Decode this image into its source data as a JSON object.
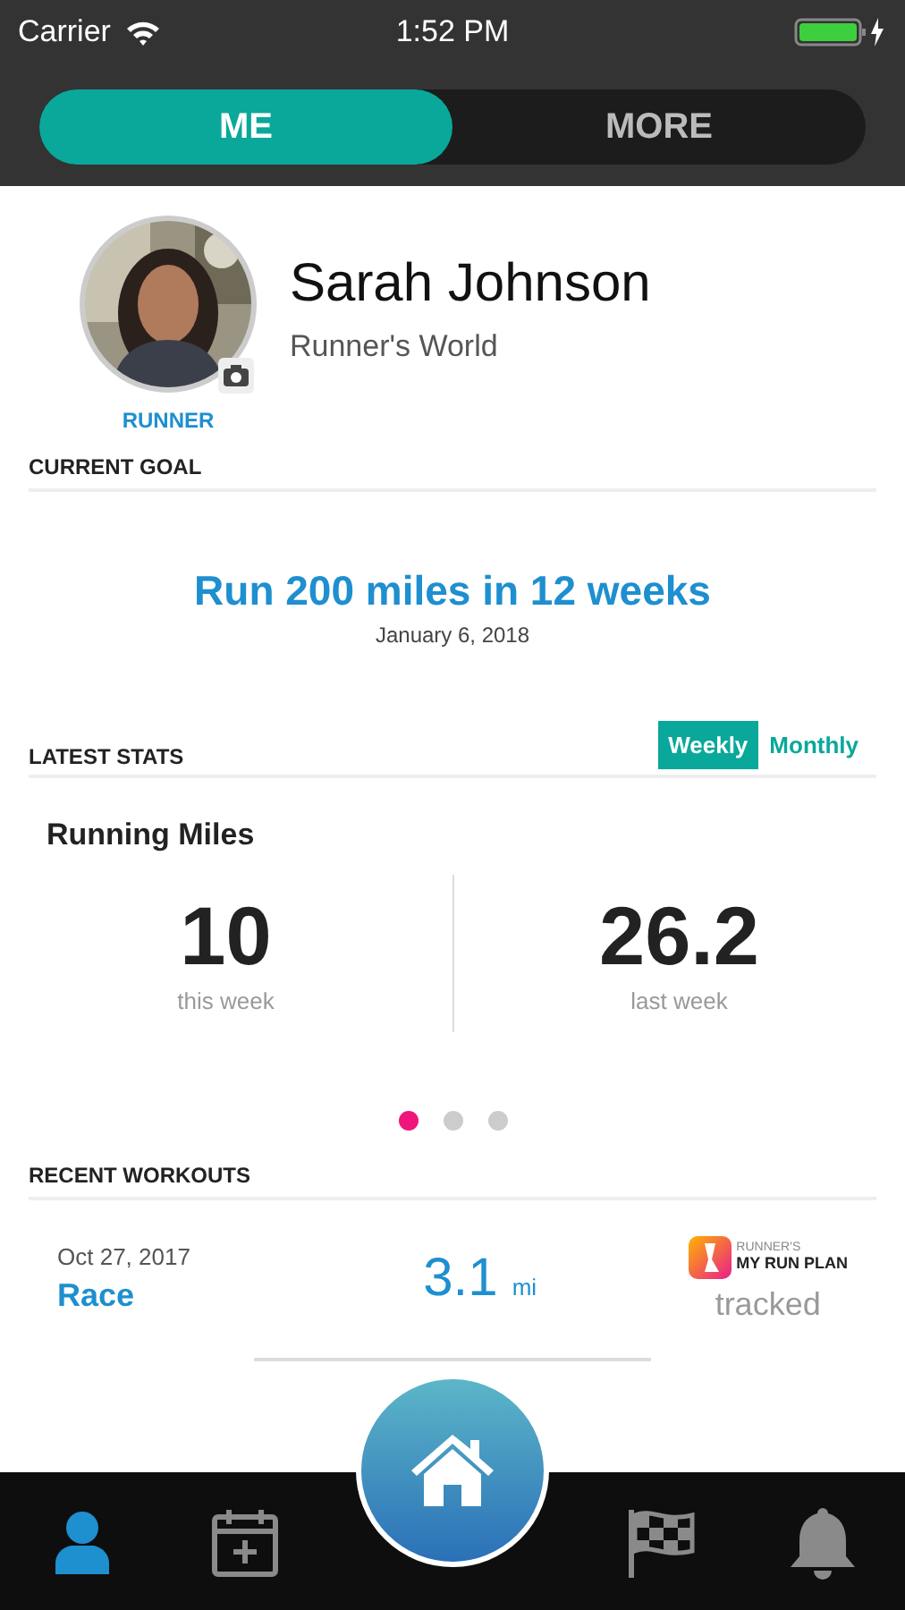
{
  "status_bar": {
    "carrier": "Carrier",
    "time": "1:52 PM"
  },
  "segments": [
    {
      "label": "ME",
      "selected": true
    },
    {
      "label": "MORE",
      "selected": false
    }
  ],
  "profile": {
    "name": "Sarah Johnson",
    "subtitle": "Runner's World",
    "role": "RUNNER"
  },
  "current_goal": {
    "heading": "CURRENT GOAL",
    "goal": "Run 200 miles in 12 weeks",
    "date": "January 6, 2018"
  },
  "latest_stats": {
    "heading": "LATEST STATS",
    "periods": [
      {
        "label": "Weekly",
        "selected": true
      },
      {
        "label": "Monthly",
        "selected": false
      }
    ],
    "title": "Running Miles",
    "stats": [
      {
        "value": "10",
        "caption": "this week"
      },
      {
        "value": "26.2",
        "caption": "last week"
      }
    ],
    "pages": [
      {
        "selected": true
      },
      {
        "selected": false
      },
      {
        "selected": false
      }
    ]
  },
  "recent_workouts": {
    "heading": "RECENT WORKOUTS",
    "items": [
      {
        "date": "Oct 27, 2017",
        "type": "Race",
        "distance": "3.1",
        "unit": "mi",
        "source_top": "RUNNER'S",
        "source_bottom": "MY RUN PLAN",
        "status": "tracked"
      }
    ]
  },
  "tab_bar": {
    "items": [
      {
        "kind": "profile",
        "selected": true
      },
      {
        "kind": "calendar",
        "selected": false
      },
      {
        "kind": "home",
        "selected": false
      },
      {
        "kind": "flag",
        "selected": false
      },
      {
        "kind": "bell",
        "selected": false
      }
    ]
  }
}
